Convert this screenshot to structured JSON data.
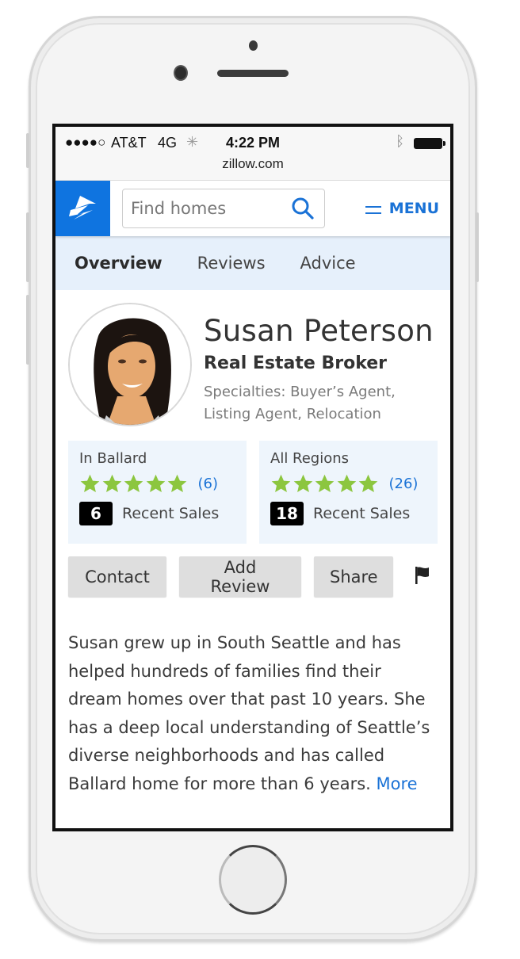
{
  "status_bar": {
    "signal": "●●●●○",
    "carrier": "AT&T",
    "network": "4G",
    "activity_glyph": "✳",
    "time": "4:22 PM",
    "bluetooth_glyph": "ᛒ",
    "url": "zillow.com"
  },
  "header": {
    "logo": "zillow-logo",
    "search_placeholder": "Find homes",
    "search_icon": "search-icon",
    "menu_label": "MENU"
  },
  "tabs": [
    {
      "label": "Overview",
      "active": true
    },
    {
      "label": "Reviews",
      "active": false
    },
    {
      "label": "Advice",
      "active": false
    }
  ],
  "agent": {
    "name": "Susan Peterson",
    "title": "Real Estate Broker",
    "specialties": "Specialties: Buyer’s Agent, Listing Agent, Relocation"
  },
  "stats": [
    {
      "region": "In Ballard",
      "rating": 5,
      "rating_max": 5,
      "review_count": "(6)",
      "recent_sales": "6",
      "sales_label": "Recent Sales"
    },
    {
      "region": "All Regions",
      "rating": 5,
      "rating_max": 5,
      "review_count": "(26)",
      "recent_sales": "18",
      "sales_label": "Recent Sales"
    }
  ],
  "actions": {
    "contact": "Contact",
    "add_review": "Add Review",
    "share": "Share",
    "flag_icon": "flag-icon"
  },
  "bio": {
    "text": "Susan grew up in South Seattle and has helped hundreds of families find their dream homes over that past 10 years. She has a deep local understanding of Seattle’s diverse neighborhoods and has called Ballard home for more than 6 years.",
    "more_link": "More"
  },
  "colors": {
    "brand_blue": "#0f74e0",
    "link_blue": "#1a72d6",
    "star_green": "#8cc63f",
    "tab_bar_bg": "#e6f0fb",
    "stat_card_bg": "#eef5fc"
  }
}
